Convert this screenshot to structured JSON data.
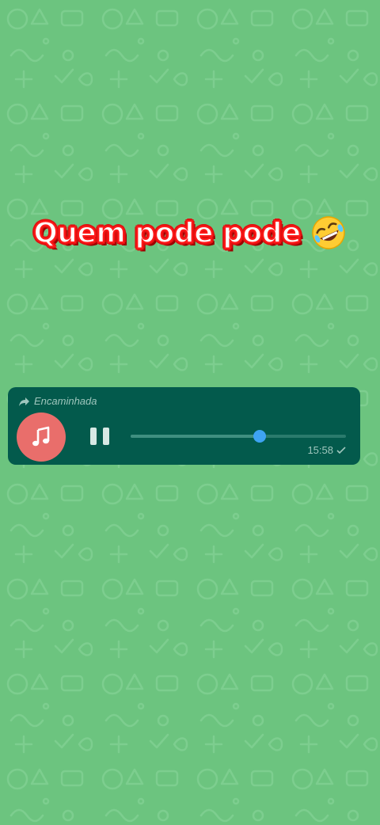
{
  "caption": {
    "text": "Quem pode pode"
  },
  "message": {
    "forwarded_label": "Encaminhada",
    "time": "15:58",
    "playback_progress_percent": 60,
    "state": "playing"
  },
  "colors": {
    "wallpaper": "#6cc47f",
    "bubble": "#035a4c",
    "avatar": "#e96e6b",
    "thumb": "#3ea3f2"
  },
  "icons": [
    "forward-arrow-icon",
    "music-note-icon",
    "pause-icon",
    "check-icon",
    "rolling-laughing-emoji"
  ]
}
